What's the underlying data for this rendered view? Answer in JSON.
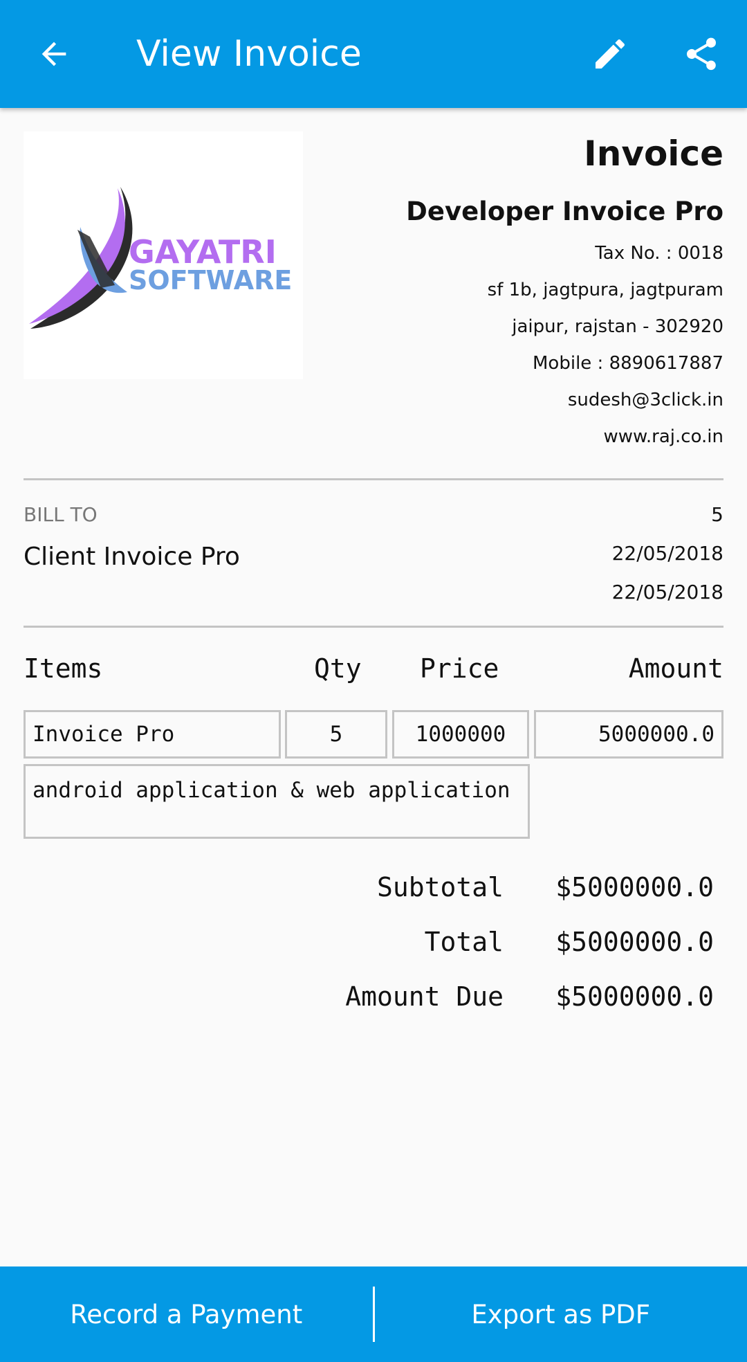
{
  "toolbar": {
    "title": "View Invoice",
    "back_icon": "arrow-left-icon",
    "edit_icon": "pencil-icon",
    "share_icon": "share-icon",
    "background": "#0499e4"
  },
  "logo": {
    "line1": "GAYATRI",
    "line2": "SOFTWARE",
    "purple": "#b36df0",
    "blue": "#6d9fe0"
  },
  "company": {
    "heading": "Invoice",
    "name": "Developer Invoice Pro",
    "tax": "Tax No. : 0018",
    "address1": "sf 1b, jagtpura, jagtpuram",
    "address2": "jaipur, rajstan - 302920",
    "mobile": "Mobile : 8890617887",
    "email": "sudesh@3click.in",
    "website": "www.raj.co.in"
  },
  "bill": {
    "label": "BILL TO",
    "client": "Client Invoice Pro",
    "invoice_number": "5",
    "date1": "22/05/2018",
    "date2": "22/05/2018"
  },
  "table": {
    "headers": {
      "items": "Items",
      "qty": "Qty",
      "price": "Price",
      "amount": "Amount"
    },
    "rows": [
      {
        "item": "Invoice Pro",
        "qty": "5",
        "price": "1000000",
        "amount": "5000000.0",
        "description": "android application & web application"
      }
    ]
  },
  "totals": {
    "subtotal_label": "Subtotal",
    "subtotal_value": "$5000000.0",
    "total_label": "Total",
    "total_value": "$5000000.0",
    "due_label": "Amount Due",
    "due_value": "$5000000.0"
  },
  "actions": {
    "record_payment": "Record a Payment",
    "export_pdf": "Export as PDF"
  }
}
